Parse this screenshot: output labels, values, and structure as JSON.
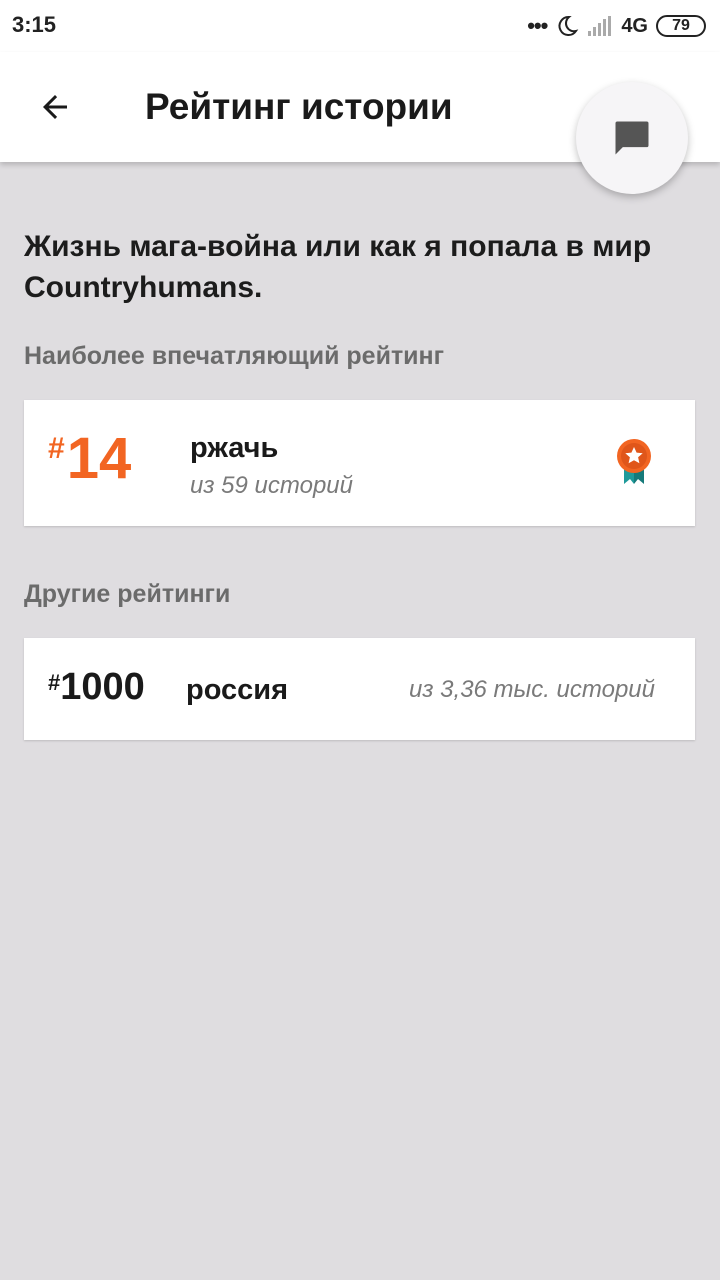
{
  "statusbar": {
    "time": "3:15",
    "dots": "•••",
    "network": "4G",
    "battery": "79"
  },
  "appbar": {
    "title": "Рейтинг истории"
  },
  "story": {
    "title": "Жизнь мага-война или как я попала в мир Countryhumans."
  },
  "sections": {
    "top_label": "Наиболее впечатляющий рейтинг",
    "other_label": "Другие рейтинги"
  },
  "top_ranking": {
    "hash": "#",
    "rank": "14",
    "tag": "ржачь",
    "out_of": "из 59 историй"
  },
  "other_rankings": [
    {
      "hash": "#",
      "rank": "1000",
      "tag": "россия",
      "out_of": "из 3,36 тыс. историй"
    }
  ],
  "colors": {
    "accent": "#f26522",
    "badge_ribbon": "#1f9a9a",
    "background": "#dfdde0"
  },
  "icons": [
    "back-arrow-icon",
    "chat-icon",
    "moon-icon",
    "signal-icon",
    "medal-icon"
  ]
}
